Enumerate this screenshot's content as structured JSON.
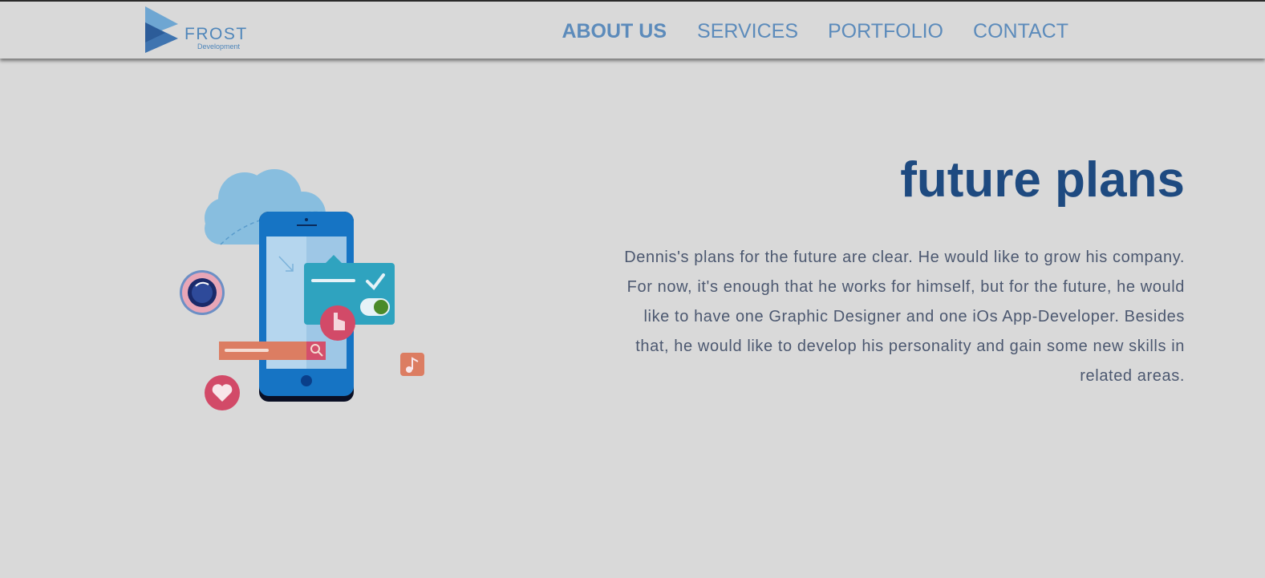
{
  "brand": {
    "name": "FROST",
    "tagline": "Development",
    "logo_icon": "triangle-play-logo-icon",
    "color": "#4f86ba"
  },
  "nav": {
    "items": [
      {
        "label": "ABOUT US",
        "active": true
      },
      {
        "label": "SERVICES",
        "active": false
      },
      {
        "label": "PORTFOLIO",
        "active": false
      },
      {
        "label": "CONTACT",
        "active": false
      }
    ],
    "color": "#5c8bbb"
  },
  "hero": {
    "illustration": "mobile-app-cloud-illustration",
    "illustration_icons": [
      "cloud-icon",
      "phone-icon",
      "camera-lens-icon",
      "notification-card-icon",
      "toggle-switch-icon",
      "pointer-hand-icon",
      "search-bar-icon",
      "heart-icon",
      "music-note-icon"
    ],
    "title": "future plans",
    "title_color": "#1e4a80",
    "paragraph": "Dennis's plans for the future are clear. He would like to grow his company. For now, it's enough that he works for himself, but for the future, he would like to have one Graphic Designer and one iOs App-Developer. Besides that, he would like to develop his personality and gain some new skills in related areas.",
    "paragraph_color": "#4c5870"
  },
  "page": {
    "background": "#d9d9d9"
  }
}
